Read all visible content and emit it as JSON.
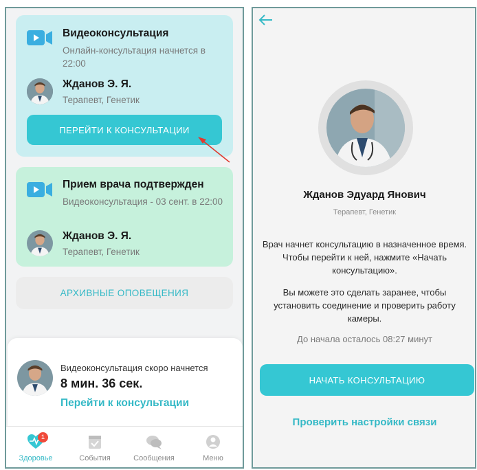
{
  "left": {
    "video_card": {
      "title": "Видеоконсультация",
      "subtitle": "Онлайн-консультация начнется в 22:00",
      "doctor_name": "Жданов Э. Я.",
      "doctor_spec": "Терапевт, Генетик",
      "button": "ПЕРЕЙТИ К КОНСУЛЬТАЦИИ"
    },
    "confirm_card": {
      "title": "Прием врача подтвержден",
      "subtitle": "Видеоконсультация - 03 сент. в 22:00",
      "doctor_name": "Жданов Э. Я.",
      "doctor_spec": "Терапевт, Генетик"
    },
    "archive_button": "АРХИВНЫЕ ОПОВЕЩЕНИЯ",
    "banner": {
      "subtitle": "Видеоконсультация скоро начнется",
      "time": "8 мин. 36 сек.",
      "link": "Перейти к консультации"
    },
    "tabs": [
      {
        "label": "Здоровье",
        "icon": "heart-pulse-icon",
        "badge": "1"
      },
      {
        "label": "События",
        "icon": "calendar-icon"
      },
      {
        "label": "Сообщения",
        "icon": "chat-icon"
      },
      {
        "label": "Меню",
        "icon": "menu-icon"
      }
    ]
  },
  "right": {
    "doctor_name": "Жданов Эдуард Янович",
    "doctor_spec": "Терапевт, Генетик",
    "paragraph1": "Врач начнет консультацию в назначенное время. Чтобы перейти к ней, нажмите «Начать консультацию».",
    "paragraph2": "Вы можете это сделать заранее, чтобы установить соединение и проверить работу камеры.",
    "timer": "До начала осталось 08:27 минут",
    "start_button": "НАЧАТЬ КОНСУЛЬТАЦИЮ",
    "check_link": "Проверить настройки связи"
  },
  "colors": {
    "accent": "#35c7d3",
    "link": "#35b9c6",
    "video_card": "#c9eef1",
    "confirm_card": "#c6f1dc",
    "badge": "#f04a3a",
    "annotation_arrow": "#e03a2f"
  }
}
